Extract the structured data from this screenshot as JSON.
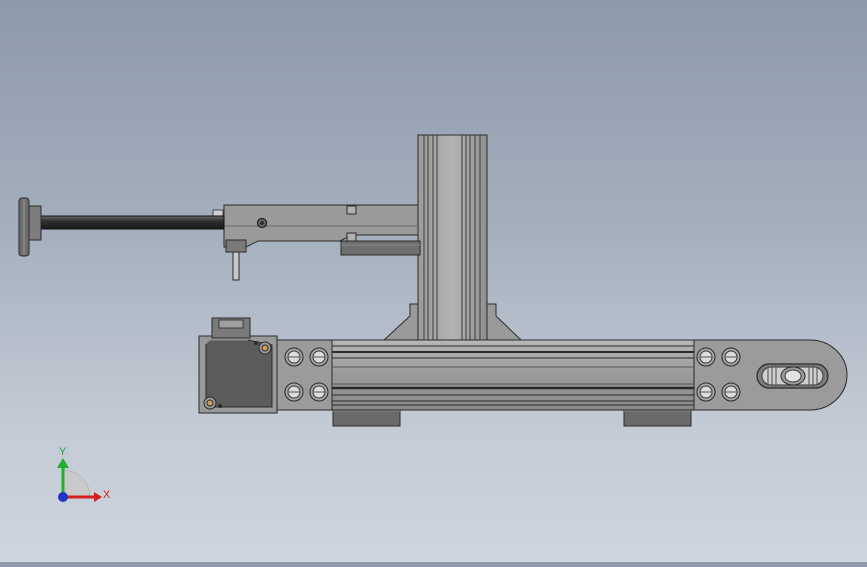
{
  "viewport": {
    "background_top": "#8d9aab",
    "background_bottom": "#cfd5de"
  },
  "triad": {
    "y_label": "Y",
    "x_label": "X",
    "y_color": "#1fae2f",
    "x_color": "#d51f1f",
    "z_color": "#1f35c8"
  },
  "model": {
    "edge_color": "#2a2a2a",
    "metal_color": "#8e8e8e",
    "dark_metal_color": "#5a5a5a"
  }
}
